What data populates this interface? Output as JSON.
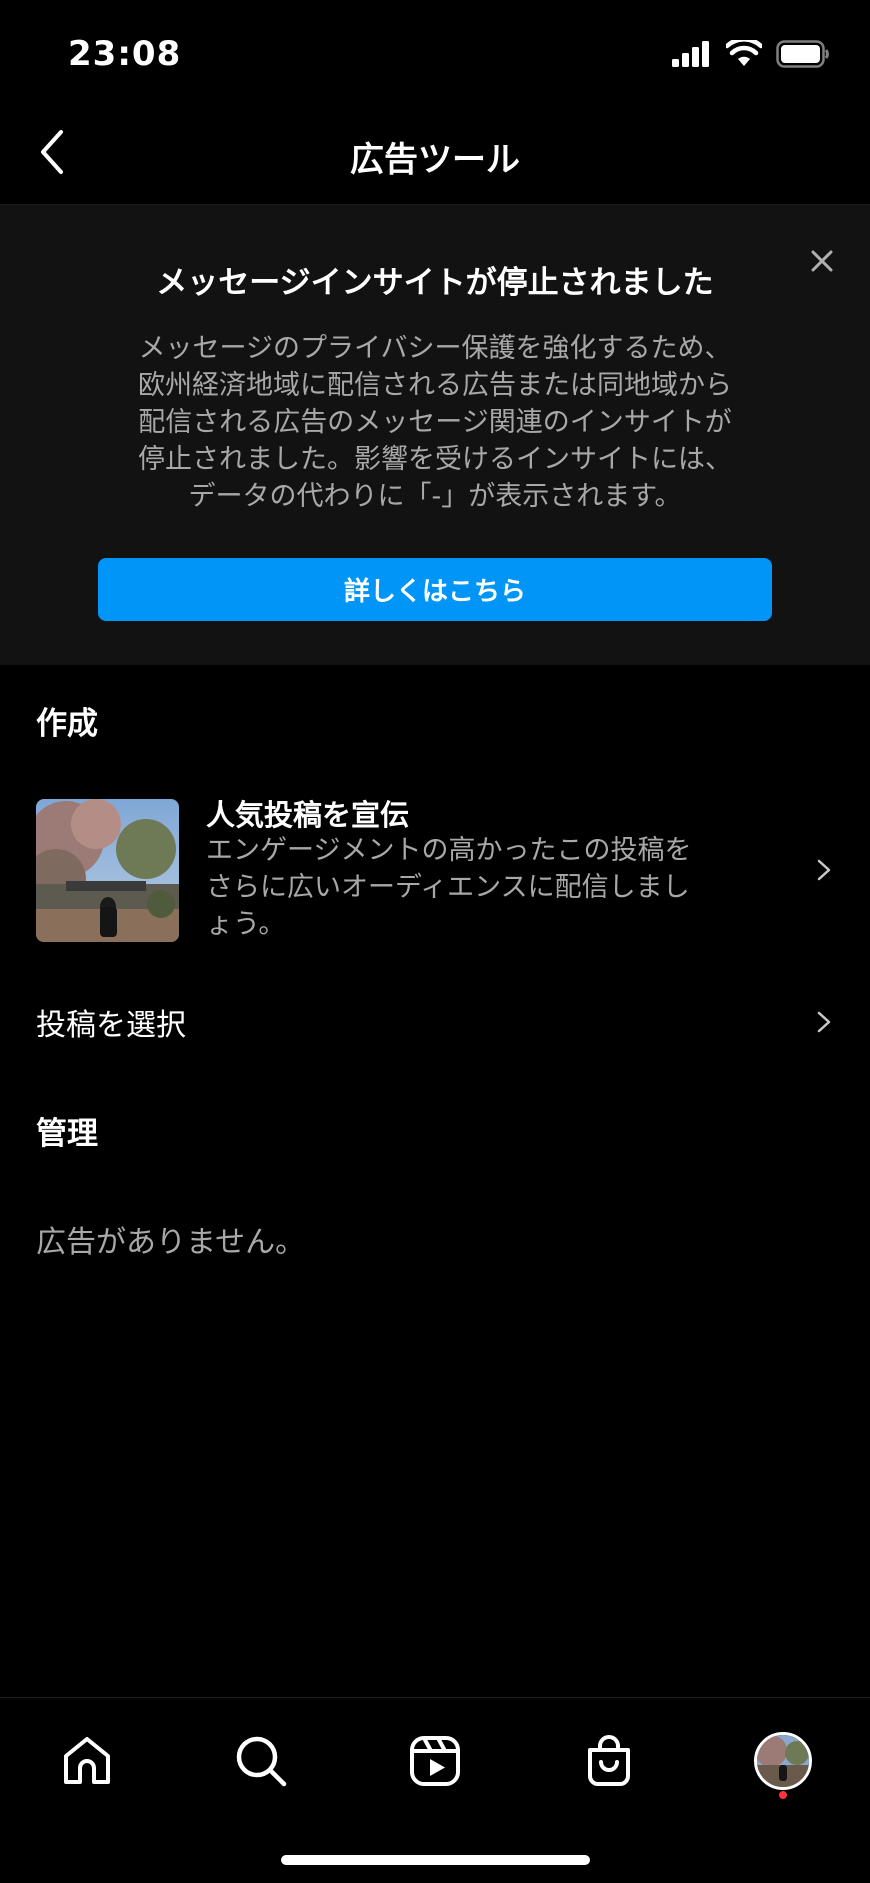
{
  "status_bar": {
    "time": "23:08"
  },
  "header": {
    "title": "広告ツール"
  },
  "notice": {
    "title": "メッセージインサイトが停止されました",
    "body_lines": [
      "メッセージのプライバシー保護を強化するため、",
      "欧州経済地域に配信される広告または同地域から",
      "配信される広告のメッセージ関連のインサイトが",
      "停止されました。影響を受けるインサイトには、",
      "データの代わりに「-」が表示されます。"
    ],
    "button_label": "詳しくはこちら"
  },
  "create_section": {
    "title": "作成",
    "promo": {
      "title": "人気投稿を宣伝",
      "description_lines": [
        "エンゲージメントの高かったこの投稿を",
        "さらに広いオーディエンスに配信しまし",
        "ょう。"
      ]
    },
    "select_post_label": "投稿を選択"
  },
  "manage_section": {
    "title": "管理",
    "empty_text": "広告がありません。"
  },
  "tab_bar": {
    "items": [
      "home-icon",
      "search-icon",
      "reels-icon",
      "shop-icon",
      "profile-avatar"
    ]
  },
  "colors": {
    "accent": "#0095f6",
    "background": "#000000",
    "banner": "#121212",
    "secondary_text": "#a8a8a8",
    "notification_dot": "#ff3040"
  }
}
